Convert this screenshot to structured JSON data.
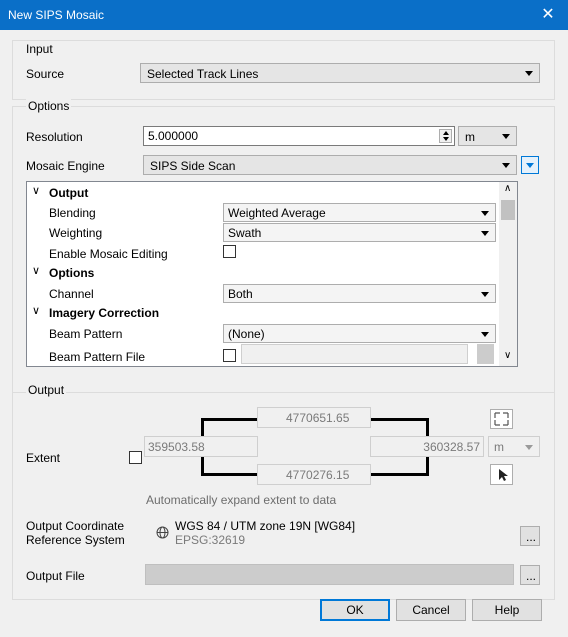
{
  "window": {
    "title": "New SIPS Mosaic",
    "close_glyph": "✕"
  },
  "input_group": {
    "label": "Input",
    "source_label": "Source",
    "source_value": "Selected Track Lines"
  },
  "options_group": {
    "label": "Options",
    "resolution_label": "Resolution",
    "resolution_value": "5.000000",
    "resolution_unit": "m",
    "engine_label": "Mosaic Engine",
    "engine_value": "SIPS Side Scan"
  },
  "property_tree": {
    "rows": [
      {
        "kind": "category",
        "label": "Output"
      },
      {
        "kind": "combo",
        "label": "Blending",
        "value": "Weighted Average"
      },
      {
        "kind": "combo",
        "label": "Weighting",
        "value": "Swath"
      },
      {
        "kind": "check",
        "label": "Enable Mosaic Editing",
        "checked": false
      },
      {
        "kind": "category",
        "label": "Options"
      },
      {
        "kind": "combo",
        "label": "Channel",
        "value": "Both"
      },
      {
        "kind": "category",
        "label": "Imagery Correction"
      },
      {
        "kind": "combo",
        "label": "Beam Pattern",
        "value": "(None)"
      },
      {
        "kind": "file",
        "label": "Beam Pattern File",
        "checked": false,
        "value": ""
      }
    ]
  },
  "output_group": {
    "label": "Output",
    "extent_label": "Extent",
    "extent_checked": false,
    "north": "4770651.65",
    "south": "4770276.15",
    "west": "359503.58",
    "east": "360328.57",
    "extent_unit": "m",
    "auto_expand_text": "Automatically expand extent to data",
    "crs_label_line1": "Output Coordinate",
    "crs_label_line2": "Reference System",
    "crs_name": "WGS 84 / UTM zone 19N [WG84]",
    "crs_code": "EPSG:32619",
    "crs_browse": "...",
    "file_label": "Output File",
    "file_value": "",
    "file_browse": "..."
  },
  "buttons": {
    "ok": "OK",
    "cancel": "Cancel",
    "help": "Help"
  }
}
